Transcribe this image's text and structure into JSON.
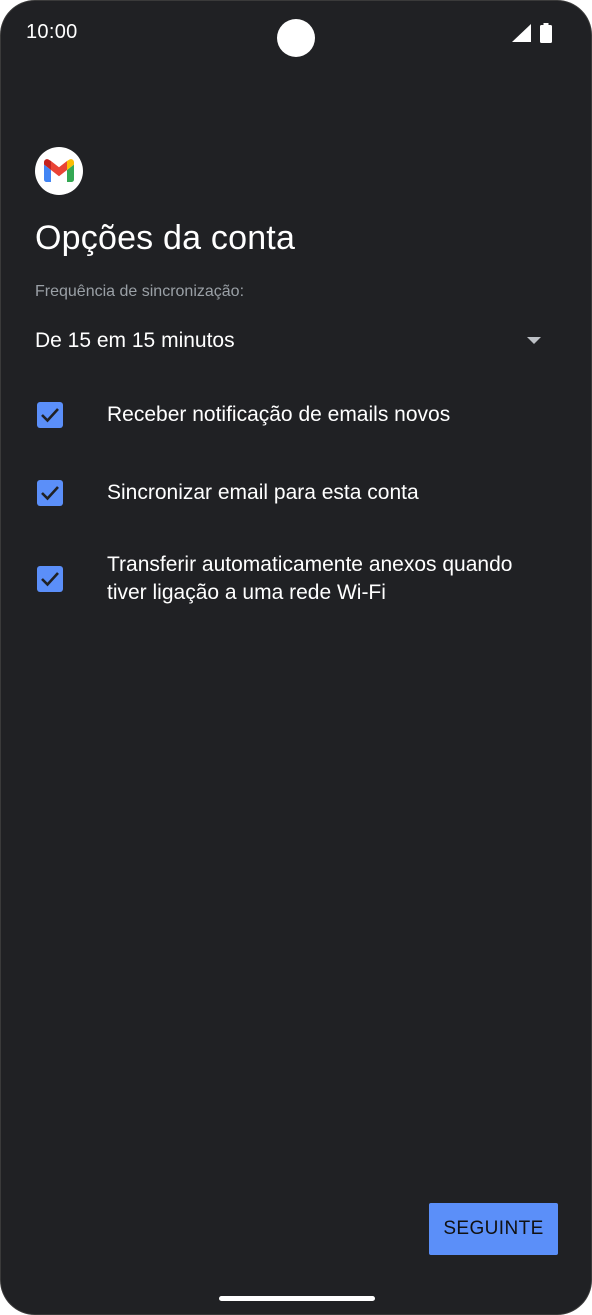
{
  "status_bar": {
    "time": "10:00"
  },
  "screen": {
    "title": "Opções da conta",
    "sync_frequency": {
      "label": "Frequência de sincronização:",
      "selected": "De 15 em 15 minutos"
    },
    "options": [
      {
        "label": "Receber notificação de emails novos",
        "checked": true
      },
      {
        "label": "Sincronizar email para esta conta",
        "checked": true
      },
      {
        "label": "Transferir automaticamente anexos quando tiver ligação a uma rede Wi-Fi",
        "checked": true
      }
    ],
    "next_label": "SEGUINTE"
  },
  "colors": {
    "background": "#202124",
    "accent": "#5b8ff9",
    "secondary_text": "#9aa0a6"
  },
  "icons": [
    "signal-icon",
    "battery-icon",
    "gmail-logo-icon",
    "dropdown-arrow-icon",
    "checkmark-icon"
  ]
}
